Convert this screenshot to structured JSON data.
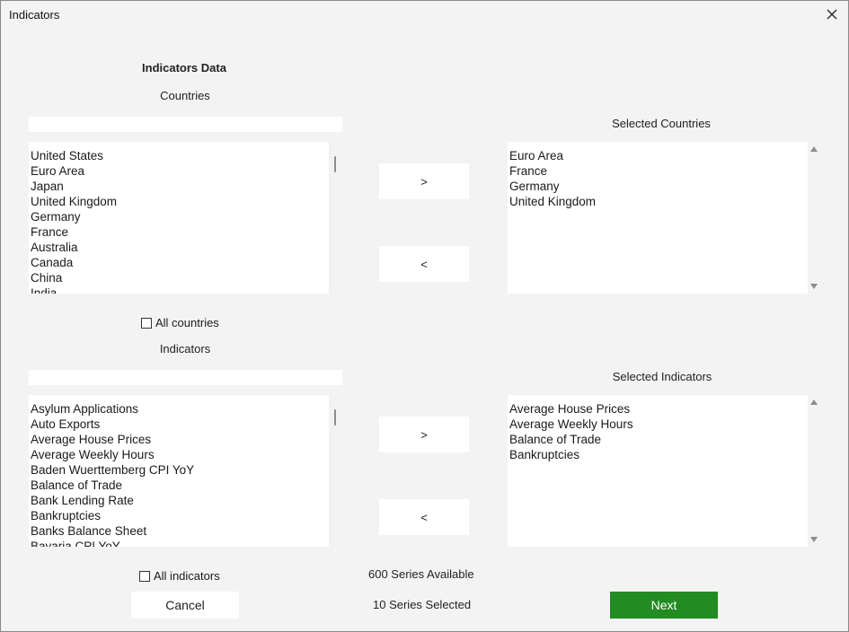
{
  "window": {
    "title": "Indicators"
  },
  "headings": {
    "main": "Indicators Data",
    "countries": "Countries",
    "selected_countries": "Selected Countries",
    "indicators": "Indicators",
    "selected_indicators": "Selected Indicators"
  },
  "countries": {
    "search_value": "",
    "items": [
      "United States",
      "Euro Area",
      "Japan",
      "United Kingdom",
      "Germany",
      "France",
      "Australia",
      "Canada",
      "China",
      "India"
    ],
    "selected": [
      "Euro Area",
      "France",
      "Germany",
      "United Kingdom"
    ],
    "add_label": ">",
    "remove_label": "<",
    "all_label": "All countries"
  },
  "indicators": {
    "search_value": "",
    "items": [
      "Asylum Applications",
      "Auto Exports",
      "Average House Prices",
      "Average Weekly Hours",
      "Baden Wuerttemberg CPI YoY",
      "Balance of Trade",
      "Bank Lending Rate",
      "Bankruptcies",
      "Banks Balance Sheet",
      "Bavaria CPI YoY"
    ],
    "selected": [
      "Average House Prices",
      "Average Weekly Hours",
      "Balance of Trade",
      "Bankruptcies"
    ],
    "add_label": ">",
    "remove_label": "<",
    "all_label": "All indicators"
  },
  "status": {
    "available": "600 Series Available",
    "selected": "10 Series Selected"
  },
  "buttons": {
    "cancel": "Cancel",
    "next": "Next"
  },
  "colors": {
    "next_bg": "#228b22",
    "background": "#f3f3f3"
  }
}
